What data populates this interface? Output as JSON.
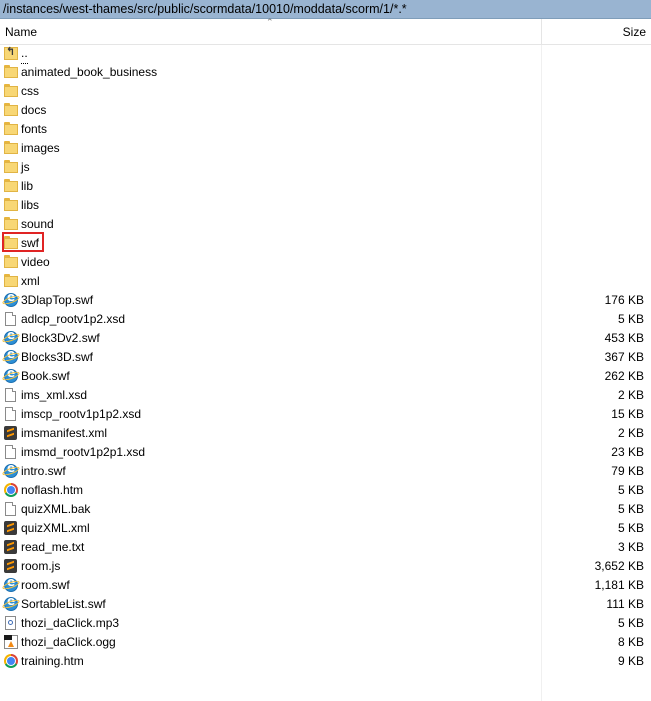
{
  "path": "/instances/west-thames/src/public/scormdata/10010/moddata/scorm/1/*.*",
  "columns": {
    "name": "Name",
    "size": "Size"
  },
  "rows": [
    {
      "name": "..",
      "size": "",
      "icon": "up-folder-icon"
    },
    {
      "name": "animated_book_business",
      "size": "",
      "icon": "folder-icon"
    },
    {
      "name": "css",
      "size": "",
      "icon": "folder-icon"
    },
    {
      "name": "docs",
      "size": "",
      "icon": "folder-icon"
    },
    {
      "name": "fonts",
      "size": "",
      "icon": "folder-icon"
    },
    {
      "name": "images",
      "size": "",
      "icon": "folder-icon"
    },
    {
      "name": "js",
      "size": "",
      "icon": "folder-icon"
    },
    {
      "name": "lib",
      "size": "",
      "icon": "folder-icon"
    },
    {
      "name": "libs",
      "size": "",
      "icon": "folder-icon"
    },
    {
      "name": "sound",
      "size": "",
      "icon": "folder-icon"
    },
    {
      "name": "swf",
      "size": "",
      "icon": "folder-icon",
      "highlighted": true
    },
    {
      "name": "video",
      "size": "",
      "icon": "folder-icon"
    },
    {
      "name": "xml",
      "size": "",
      "icon": "folder-icon"
    },
    {
      "name": "3DlapTop.swf",
      "size": "176 KB",
      "icon": "ie-icon"
    },
    {
      "name": "adlcp_rootv1p2.xsd",
      "size": "5 KB",
      "icon": "document-icon"
    },
    {
      "name": "Block3Dv2.swf",
      "size": "453 KB",
      "icon": "ie-icon"
    },
    {
      "name": "Blocks3D.swf",
      "size": "367 KB",
      "icon": "ie-icon"
    },
    {
      "name": "Book.swf",
      "size": "262 KB",
      "icon": "ie-icon"
    },
    {
      "name": "ims_xml.xsd",
      "size": "2 KB",
      "icon": "document-icon"
    },
    {
      "name": "imscp_rootv1p1p2.xsd",
      "size": "15 KB",
      "icon": "document-icon"
    },
    {
      "name": "imsmanifest.xml",
      "size": "2 KB",
      "icon": "sublime-icon"
    },
    {
      "name": "imsmd_rootv1p2p1.xsd",
      "size": "23 KB",
      "icon": "document-icon"
    },
    {
      "name": "intro.swf",
      "size": "79 KB",
      "icon": "ie-icon"
    },
    {
      "name": "noflash.htm",
      "size": "5 KB",
      "icon": "chrome-icon"
    },
    {
      "name": "quizXML.bak",
      "size": "5 KB",
      "icon": "document-icon"
    },
    {
      "name": "quizXML.xml",
      "size": "5 KB",
      "icon": "sublime-icon"
    },
    {
      "name": "read_me.txt",
      "size": "3 KB",
      "icon": "sublime-icon"
    },
    {
      "name": "room.js",
      "size": "3,652 KB",
      "icon": "sublime-icon"
    },
    {
      "name": "room.swf",
      "size": "1,181 KB",
      "icon": "ie-icon"
    },
    {
      "name": "SortableList.swf",
      "size": "111 KB",
      "icon": "ie-icon"
    },
    {
      "name": "thozi_daClick.mp3",
      "size": "5 KB",
      "icon": "audio-icon"
    },
    {
      "name": "thozi_daClick.ogg",
      "size": "8 KB",
      "icon": "vlc-icon"
    },
    {
      "name": "training.htm",
      "size": "9 KB",
      "icon": "chrome-icon"
    }
  ],
  "colors": {
    "path_bar": "#99b4d1",
    "highlight_box": "#e02424"
  }
}
